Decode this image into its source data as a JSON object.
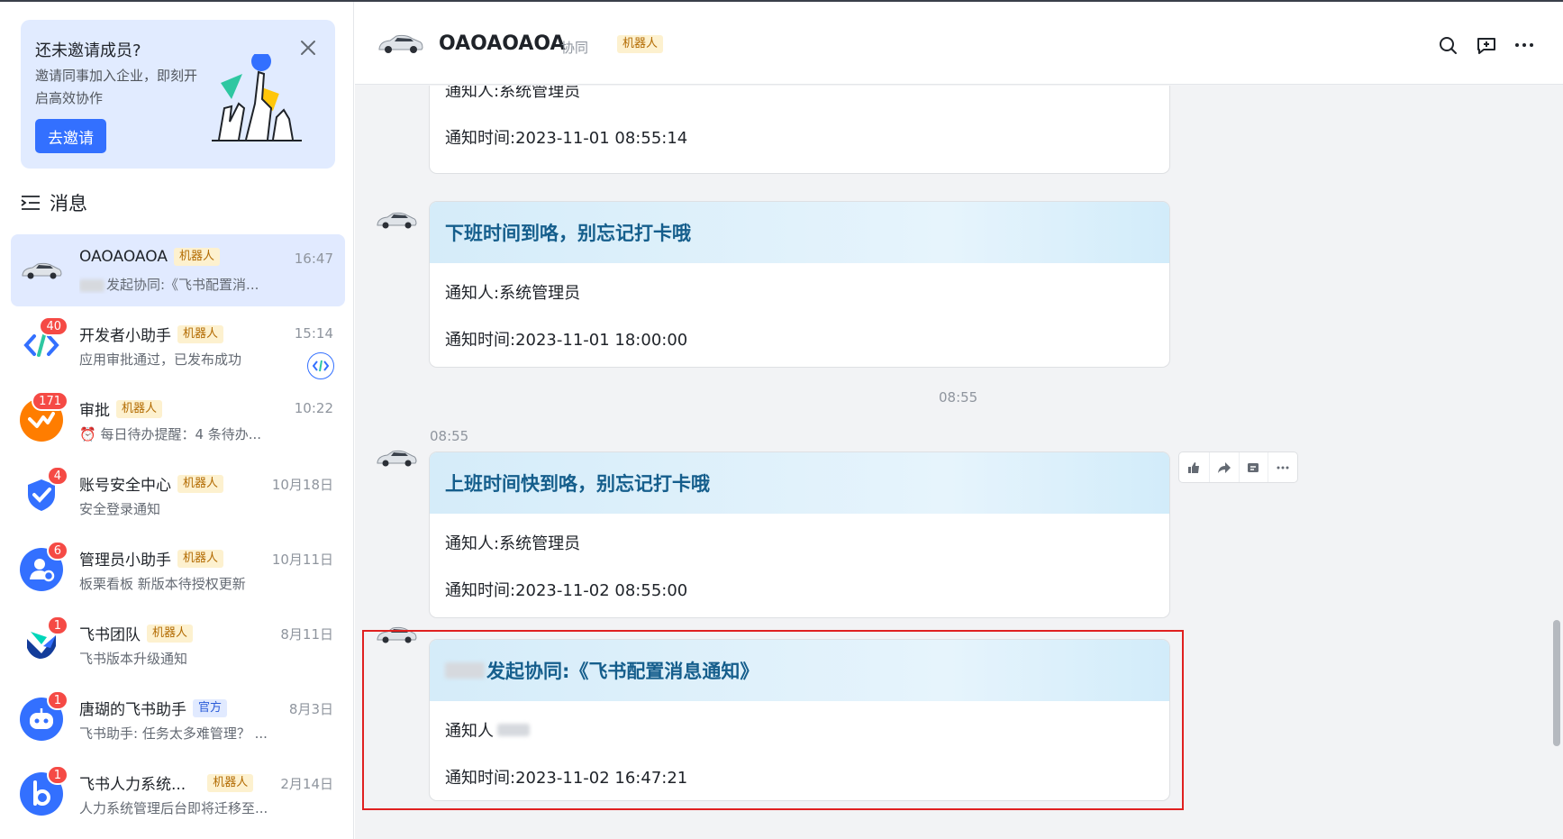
{
  "invite": {
    "title": "还未邀请成员?",
    "description": "邀请同事加入企业，即刻开启高效协作",
    "button": "去邀请"
  },
  "section": {
    "title": "消息"
  },
  "chats": [
    {
      "name": "OAOAOAOA",
      "tag": "机器人",
      "time": "16:47",
      "preview": "发起协同:《飞书配置消...",
      "badge": ""
    },
    {
      "name": "开发者小助手",
      "tag": "机器人",
      "time": "15:14",
      "preview": "应用审批通过，已发布成功",
      "badge": "40"
    },
    {
      "name": "审批",
      "tag": "机器人",
      "time": "10:22",
      "preview": "⏰ 每日待办提醒：4 条待办...",
      "badge": "171"
    },
    {
      "name": "账号安全中心",
      "tag": "机器人",
      "time": "10月18日",
      "preview": "安全登录通知",
      "badge": "4"
    },
    {
      "name": "管理员小助手",
      "tag": "机器人",
      "time": "10月11日",
      "preview": "板栗看板 新版本待授权更新",
      "badge": "6"
    },
    {
      "name": "飞书团队",
      "tag": "机器人",
      "time": "8月11日",
      "preview": "飞书版本升级通知",
      "badge": "1"
    },
    {
      "name": "唐瑚的飞书助手",
      "tag": "官方",
      "time": "8月3日",
      "preview": "飞书助手: 任务太多难管理？ ...",
      "badge": "1"
    },
    {
      "name": "飞书人力系统...",
      "tag": "机器人",
      "time": "2月14日",
      "preview": "人力系统管理后台即将迁移至...",
      "badge": "1"
    }
  ],
  "header": {
    "title": "OAOAOAOA",
    "subtitle": "协同",
    "tag": "机器人"
  },
  "messages": {
    "card0": {
      "notifier": "通知人:系统管理员",
      "time": "通知时间:2023-11-01 08:55:14"
    },
    "card1": {
      "title": "下班时间到咯，别忘记打卡哦",
      "notifier": "通知人:系统管理员",
      "time": "通知时间:2023-11-01 18:00:00"
    },
    "divider_time": "08:55",
    "sender_time": "08:55",
    "card2": {
      "title": "上班时间快到咯，别忘记打卡哦",
      "notifier": "通知人:系统管理员",
      "time": "通知时间:2023-11-02 08:55:00"
    },
    "card3": {
      "title": "发起协同:《飞书配置消息通知》",
      "notifier": "通知人",
      "time": "通知时间:2023-11-02 16:47:21"
    }
  },
  "colors": {
    "accent": "#3370ff",
    "badge": "#f54a45",
    "highlight": "#e02020",
    "card_title": "#155e8c"
  }
}
